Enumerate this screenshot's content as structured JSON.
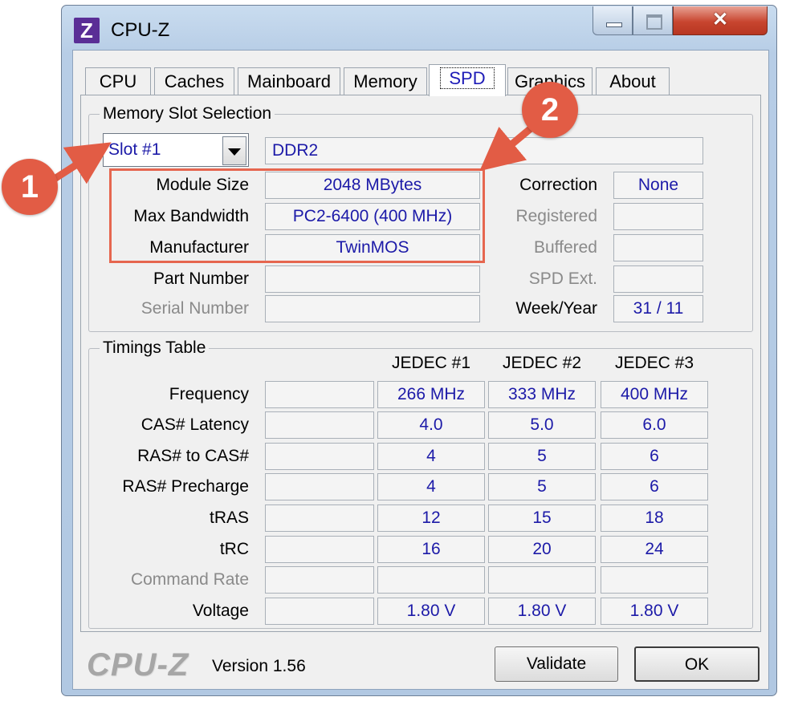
{
  "window": {
    "app_icon_letter": "Z",
    "title": "CPU-Z",
    "controls": {
      "minimize": "minimize",
      "maximize": "maximize",
      "close": "✕"
    }
  },
  "tabs": [
    "CPU",
    "Caches",
    "Mainboard",
    "Memory",
    "SPD",
    "Graphics",
    "About"
  ],
  "active_tab": "SPD",
  "memory_slot": {
    "group_title": "Memory Slot Selection",
    "slot_selected": "Slot #1",
    "memory_type": "DDR2",
    "left_labels": [
      "Module Size",
      "Max Bandwidth",
      "Manufacturer",
      "Part Number",
      "Serial Number"
    ],
    "left_values": [
      "2048 MBytes",
      "PC2-6400 (400 MHz)",
      "TwinMOS",
      "",
      ""
    ],
    "right_labels": [
      "Correction",
      "Registered",
      "Buffered",
      "SPD Ext.",
      "Week/Year"
    ],
    "right_values": [
      "None",
      "",
      "",
      "",
      "31 / 11"
    ]
  },
  "timings": {
    "group_title": "Timings Table",
    "columns": [
      "JEDEC #1",
      "JEDEC #2",
      "JEDEC #3"
    ],
    "rows": [
      {
        "label": "Frequency",
        "values": [
          "266 MHz",
          "333 MHz",
          "400 MHz"
        ]
      },
      {
        "label": "CAS# Latency",
        "values": [
          "4.0",
          "5.0",
          "6.0"
        ]
      },
      {
        "label": "RAS# to CAS#",
        "values": [
          "4",
          "5",
          "6"
        ]
      },
      {
        "label": "RAS# Precharge",
        "values": [
          "4",
          "5",
          "6"
        ]
      },
      {
        "label": "tRAS",
        "values": [
          "12",
          "15",
          "18"
        ]
      },
      {
        "label": "tRC",
        "values": [
          "16",
          "20",
          "24"
        ]
      },
      {
        "label": "Command Rate",
        "values": [
          "",
          "",
          ""
        ]
      },
      {
        "label": "Voltage",
        "values": [
          "1.80 V",
          "1.80 V",
          "1.80 V"
        ]
      }
    ]
  },
  "footer": {
    "logo": "CPU-Z",
    "version": "Version 1.56",
    "validate_button": "Validate",
    "ok_button": "OK"
  },
  "annotations": {
    "callout_1": "1",
    "callout_2": "2",
    "color": "#e25c45"
  }
}
